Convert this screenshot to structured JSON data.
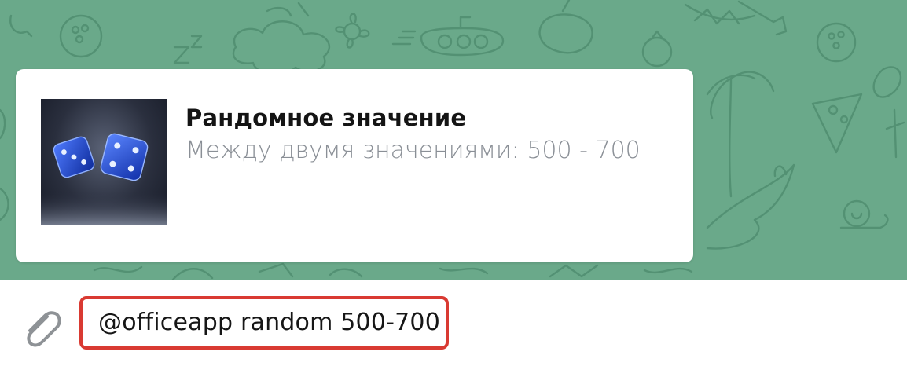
{
  "inline_results": [
    {
      "title": "Рандомное значение",
      "description": "Между двумя значениями: 500 - 700",
      "thumbnail_icon": "dice-icon"
    }
  ],
  "compose": {
    "input_value": "@officeapp random 500-700",
    "attach_icon": "paperclip-icon"
  },
  "colors": {
    "chat_background": "#6aa98a",
    "doodle_stroke": "#4f8d70",
    "highlight": "#d93a32",
    "dice": "#1f4fd8"
  }
}
